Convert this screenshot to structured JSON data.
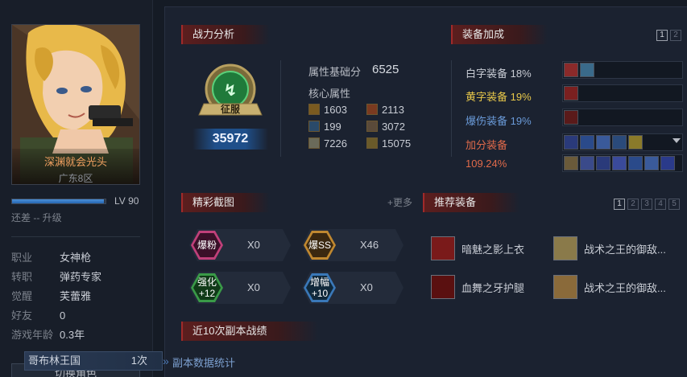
{
  "profile": {
    "name": "深渊就会光头",
    "server": "广东8区",
    "level_label": "LV 90",
    "level_progress": 0.98,
    "remain_text": "还差 -- 升级",
    "info": [
      {
        "key": "职业",
        "value": "女神枪"
      },
      {
        "key": "转职",
        "value": "弹药专家"
      },
      {
        "key": "觉醒",
        "value": "芙蕾雅"
      },
      {
        "key": "好友",
        "value": "0"
      },
      {
        "key": "游戏年龄",
        "value": "0.3年"
      }
    ],
    "switch_label": "切换角色"
  },
  "combat": {
    "title": "战力分析",
    "rank_label": "征服",
    "score": "35972",
    "base_label": "属性基础分",
    "base_value": "6525",
    "core_label": "核心属性",
    "stats": [
      {
        "icon": "strength-icon",
        "value": "1603"
      },
      {
        "icon": "intelligence-icon",
        "value": "2113"
      },
      {
        "icon": "physical-attack-icon",
        "value": "199"
      },
      {
        "icon": "magic-attack-icon",
        "value": "3072"
      },
      {
        "icon": "independent-attack-icon",
        "value": "7226"
      },
      {
        "icon": "element-icon",
        "value": "15075"
      }
    ]
  },
  "equipment_bonus": {
    "title": "装备加成",
    "pages": [
      "1",
      "2"
    ],
    "active_page": "1",
    "rows": [
      {
        "label": "白字装备 18%",
        "color": "#c8ccd4"
      },
      {
        "label": "黄字装备 19%",
        "color": "#e8c84a"
      },
      {
        "label": "爆伤装备 19%",
        "color": "#6a9ad8"
      },
      {
        "label": "加分装备",
        "color": "#e06a4a"
      }
    ],
    "bonus_value": "109.24%"
  },
  "highlights": {
    "title": "精彩截图",
    "more": "+更多",
    "badges": [
      {
        "label": "爆粉",
        "count": "X0",
        "color": "#c0407a"
      },
      {
        "label": "爆SS",
        "count": "X46",
        "color": "#c08830"
      },
      {
        "label": "强化 +12",
        "line1": "强化",
        "line2": "+12",
        "count": "X0",
        "color": "#3a9a48"
      },
      {
        "label": "增幅 +10",
        "line1": "增幅",
        "line2": "+10",
        "count": "X0",
        "color": "#3a78b8"
      }
    ]
  },
  "recommend": {
    "title": "推荐装备",
    "pages": [
      "1",
      "2",
      "3",
      "4",
      "5"
    ],
    "active_page": "1",
    "items": [
      {
        "name": "暗魅之影上衣"
      },
      {
        "name": "战术之王的御敌..."
      },
      {
        "name": "血舞之牙护腿"
      },
      {
        "name": "战术之王的御敌..."
      }
    ]
  },
  "dungeons": {
    "title": "近10次副本战绩",
    "row": {
      "name": "哥布林王国",
      "count": "1次"
    },
    "stats_label": "副本数据统计"
  }
}
